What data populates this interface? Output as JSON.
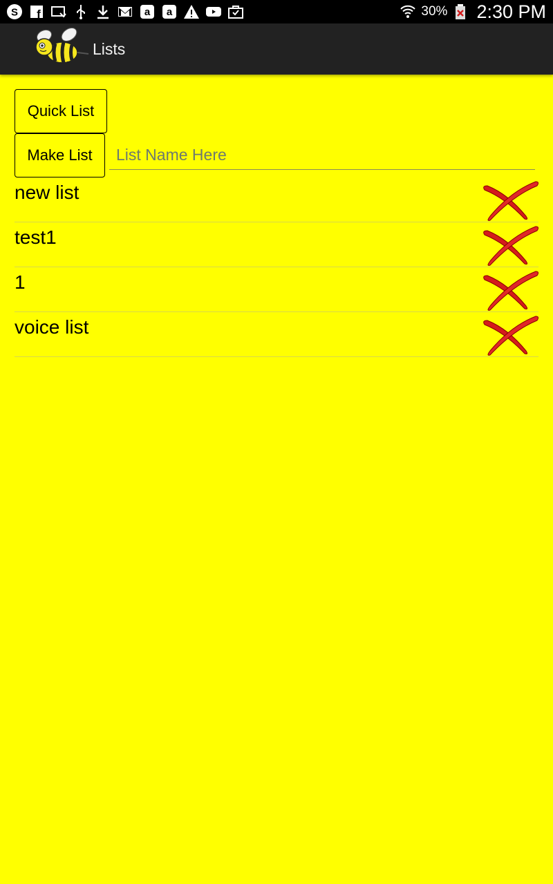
{
  "status_bar": {
    "left_icons": [
      "skype-icon",
      "facebook-icon",
      "cast-icon",
      "usb-icon",
      "download-icon",
      "gmail-icon",
      "amazon-icon",
      "amazon-icon-2",
      "warning-icon",
      "youtube-icon",
      "briefcase-icon"
    ],
    "battery_percent": "30%",
    "time": "2:30 PM"
  },
  "action_bar": {
    "title": "Lists",
    "logo_icon": "bee-icon"
  },
  "buttons": {
    "quick_list": "Quick List",
    "make_list": "Make List"
  },
  "list_name_input": {
    "value": "",
    "placeholder": "List Name Here"
  },
  "lists": [
    {
      "name": "new list",
      "delete_icon": "red-x-icon"
    },
    {
      "name": "test1",
      "delete_icon": "red-x-icon"
    },
    {
      "name": "1",
      "delete_icon": "red-x-icon"
    },
    {
      "name": "voice list",
      "delete_icon": "red-x-icon"
    }
  ],
  "colors": {
    "background": "#ffff00",
    "action_bar": "#222222",
    "status_bar": "#000000",
    "delete_red": "#d41c1c"
  }
}
